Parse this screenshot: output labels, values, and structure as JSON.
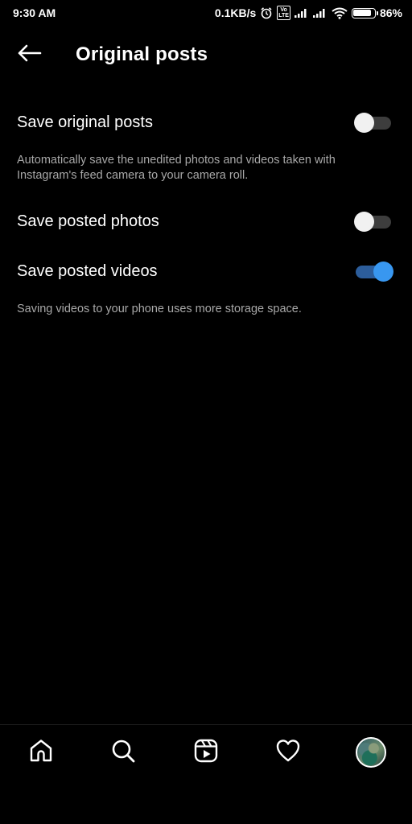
{
  "status_bar": {
    "time": "9:30 AM",
    "net_speed": "0.1KB/s",
    "volte": "Vo LTE",
    "battery_percent": "86%",
    "battery_level": 0.86
  },
  "header": {
    "title": "Original posts"
  },
  "settings": {
    "save_original_posts": {
      "label": "Save original posts",
      "enabled": false,
      "description": "Automatically save the unedited photos and videos taken with Instagram's feed camera to your camera roll."
    },
    "save_posted_photos": {
      "label": "Save posted photos",
      "enabled": false
    },
    "save_posted_videos": {
      "label": "Save posted videos",
      "enabled": true,
      "description": "Saving videos to your phone uses more storage space."
    }
  },
  "bottom_nav": {
    "items": [
      "home-icon",
      "search-icon",
      "reels-icon",
      "heart-icon",
      "profile-avatar"
    ]
  },
  "colors": {
    "background": "#000000",
    "toggle_on_knob": "#3897f0",
    "toggle_on_track": "#2c5d9b",
    "description_text": "#a8a8a8"
  }
}
